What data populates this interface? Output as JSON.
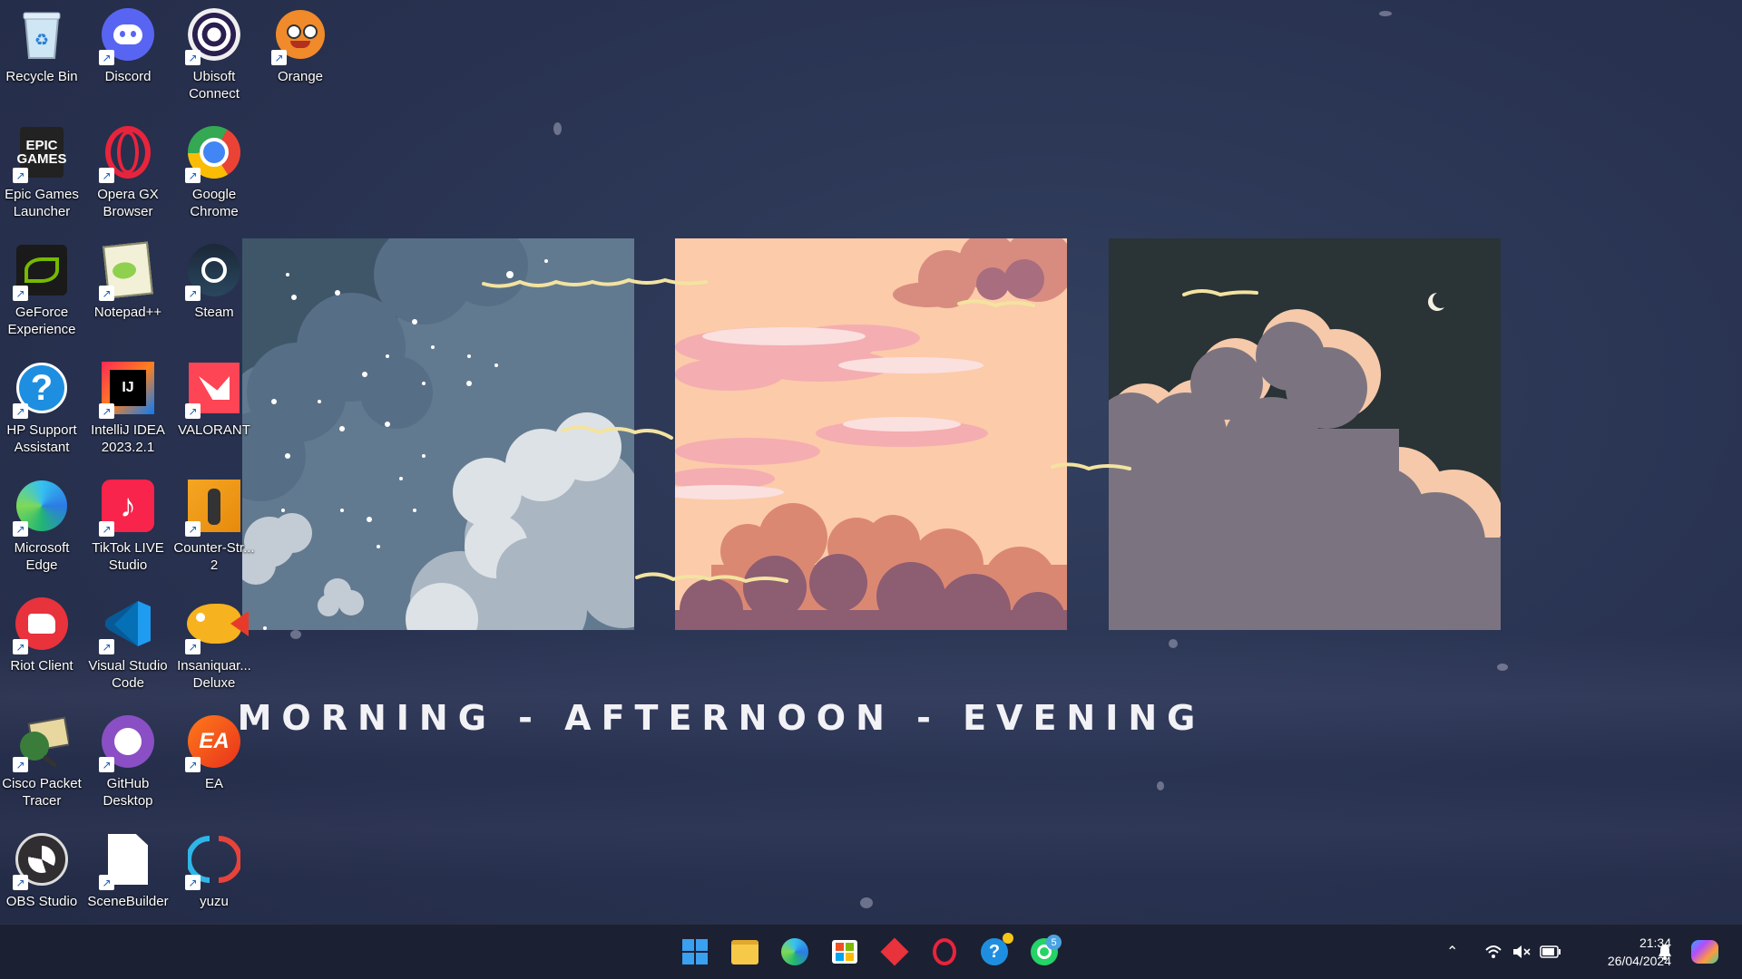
{
  "desktop": {
    "icons": [
      {
        "label": "Recycle Bin",
        "icon": "recycle-bin-icon"
      },
      {
        "label": "Discord",
        "icon": "discord-icon"
      },
      {
        "label": "Ubisoft Connect",
        "icon": "ubisoft-icon"
      },
      {
        "label": "Orange",
        "icon": "orange-icon"
      },
      {
        "label": "Epic Games Launcher",
        "icon": "epic-games-icon",
        "logo_text": "EPIC GAMES"
      },
      {
        "label": "Opera GX Browser",
        "icon": "opera-gx-icon"
      },
      {
        "label": "Google Chrome",
        "icon": "chrome-icon"
      },
      {
        "label": "GeForce Experience",
        "icon": "geforce-icon"
      },
      {
        "label": "Notepad++",
        "icon": "notepad-plus-plus-icon"
      },
      {
        "label": "Steam",
        "icon": "steam-icon"
      },
      {
        "label": "HP Support Assistant",
        "icon": "hp-support-icon"
      },
      {
        "label": "IntelliJ IDEA 2023.2.1",
        "icon": "intellij-icon",
        "logo_text": "IJ"
      },
      {
        "label": "VALORANT",
        "icon": "valorant-icon"
      },
      {
        "label": "Microsoft Edge",
        "icon": "edge-icon"
      },
      {
        "label": "TikTok LIVE Studio",
        "icon": "tiktok-live-icon"
      },
      {
        "label": "Counter-Str... 2",
        "icon": "counter-strike-icon"
      },
      {
        "label": "Riot Client",
        "icon": "riot-client-icon"
      },
      {
        "label": "Visual Studio Code",
        "icon": "vscode-icon"
      },
      {
        "label": "Insaniquar... Deluxe",
        "icon": "insaniquarium-icon"
      },
      {
        "label": "Cisco Packet Tracer",
        "icon": "cisco-packet-tracer-icon"
      },
      {
        "label": "GitHub Desktop",
        "icon": "github-desktop-icon"
      },
      {
        "label": "EA",
        "icon": "ea-icon",
        "logo_text": "EA"
      },
      {
        "label": "OBS Studio",
        "icon": "obs-icon"
      },
      {
        "label": "SceneBuilder",
        "icon": "scenebuilder-icon"
      },
      {
        "label": "yuzu",
        "icon": "yuzu-icon"
      }
    ]
  },
  "wallpaper": {
    "tagline": "MORNING - AFTERNOON - EVENING",
    "panels": [
      "morning-panel",
      "afternoon-panel",
      "evening-panel"
    ]
  },
  "taskbar": {
    "apps": [
      {
        "name": "start-button",
        "icon": "windows-logo-icon"
      },
      {
        "name": "file-explorer",
        "icon": "folder-icon"
      },
      {
        "name": "microsoft-edge",
        "icon": "edge-icon"
      },
      {
        "name": "microsoft-store",
        "icon": "store-icon"
      },
      {
        "name": "app-red",
        "icon": "red-diamond-icon"
      },
      {
        "name": "opera-gx",
        "icon": "opera-gx-icon"
      },
      {
        "name": "hp-support",
        "icon": "hp-support-icon"
      },
      {
        "name": "whatsapp",
        "icon": "whatsapp-icon",
        "badge": "5"
      }
    ],
    "time": "21:34",
    "date": "26/04/2024"
  },
  "colors": {
    "taskbar_bg": "#1c2033",
    "wallpaper_bg": "#2a3453",
    "morning_sky": "#627a90",
    "afternoon_sky": "#fccbaa",
    "evening_sky": "#2a3336"
  }
}
